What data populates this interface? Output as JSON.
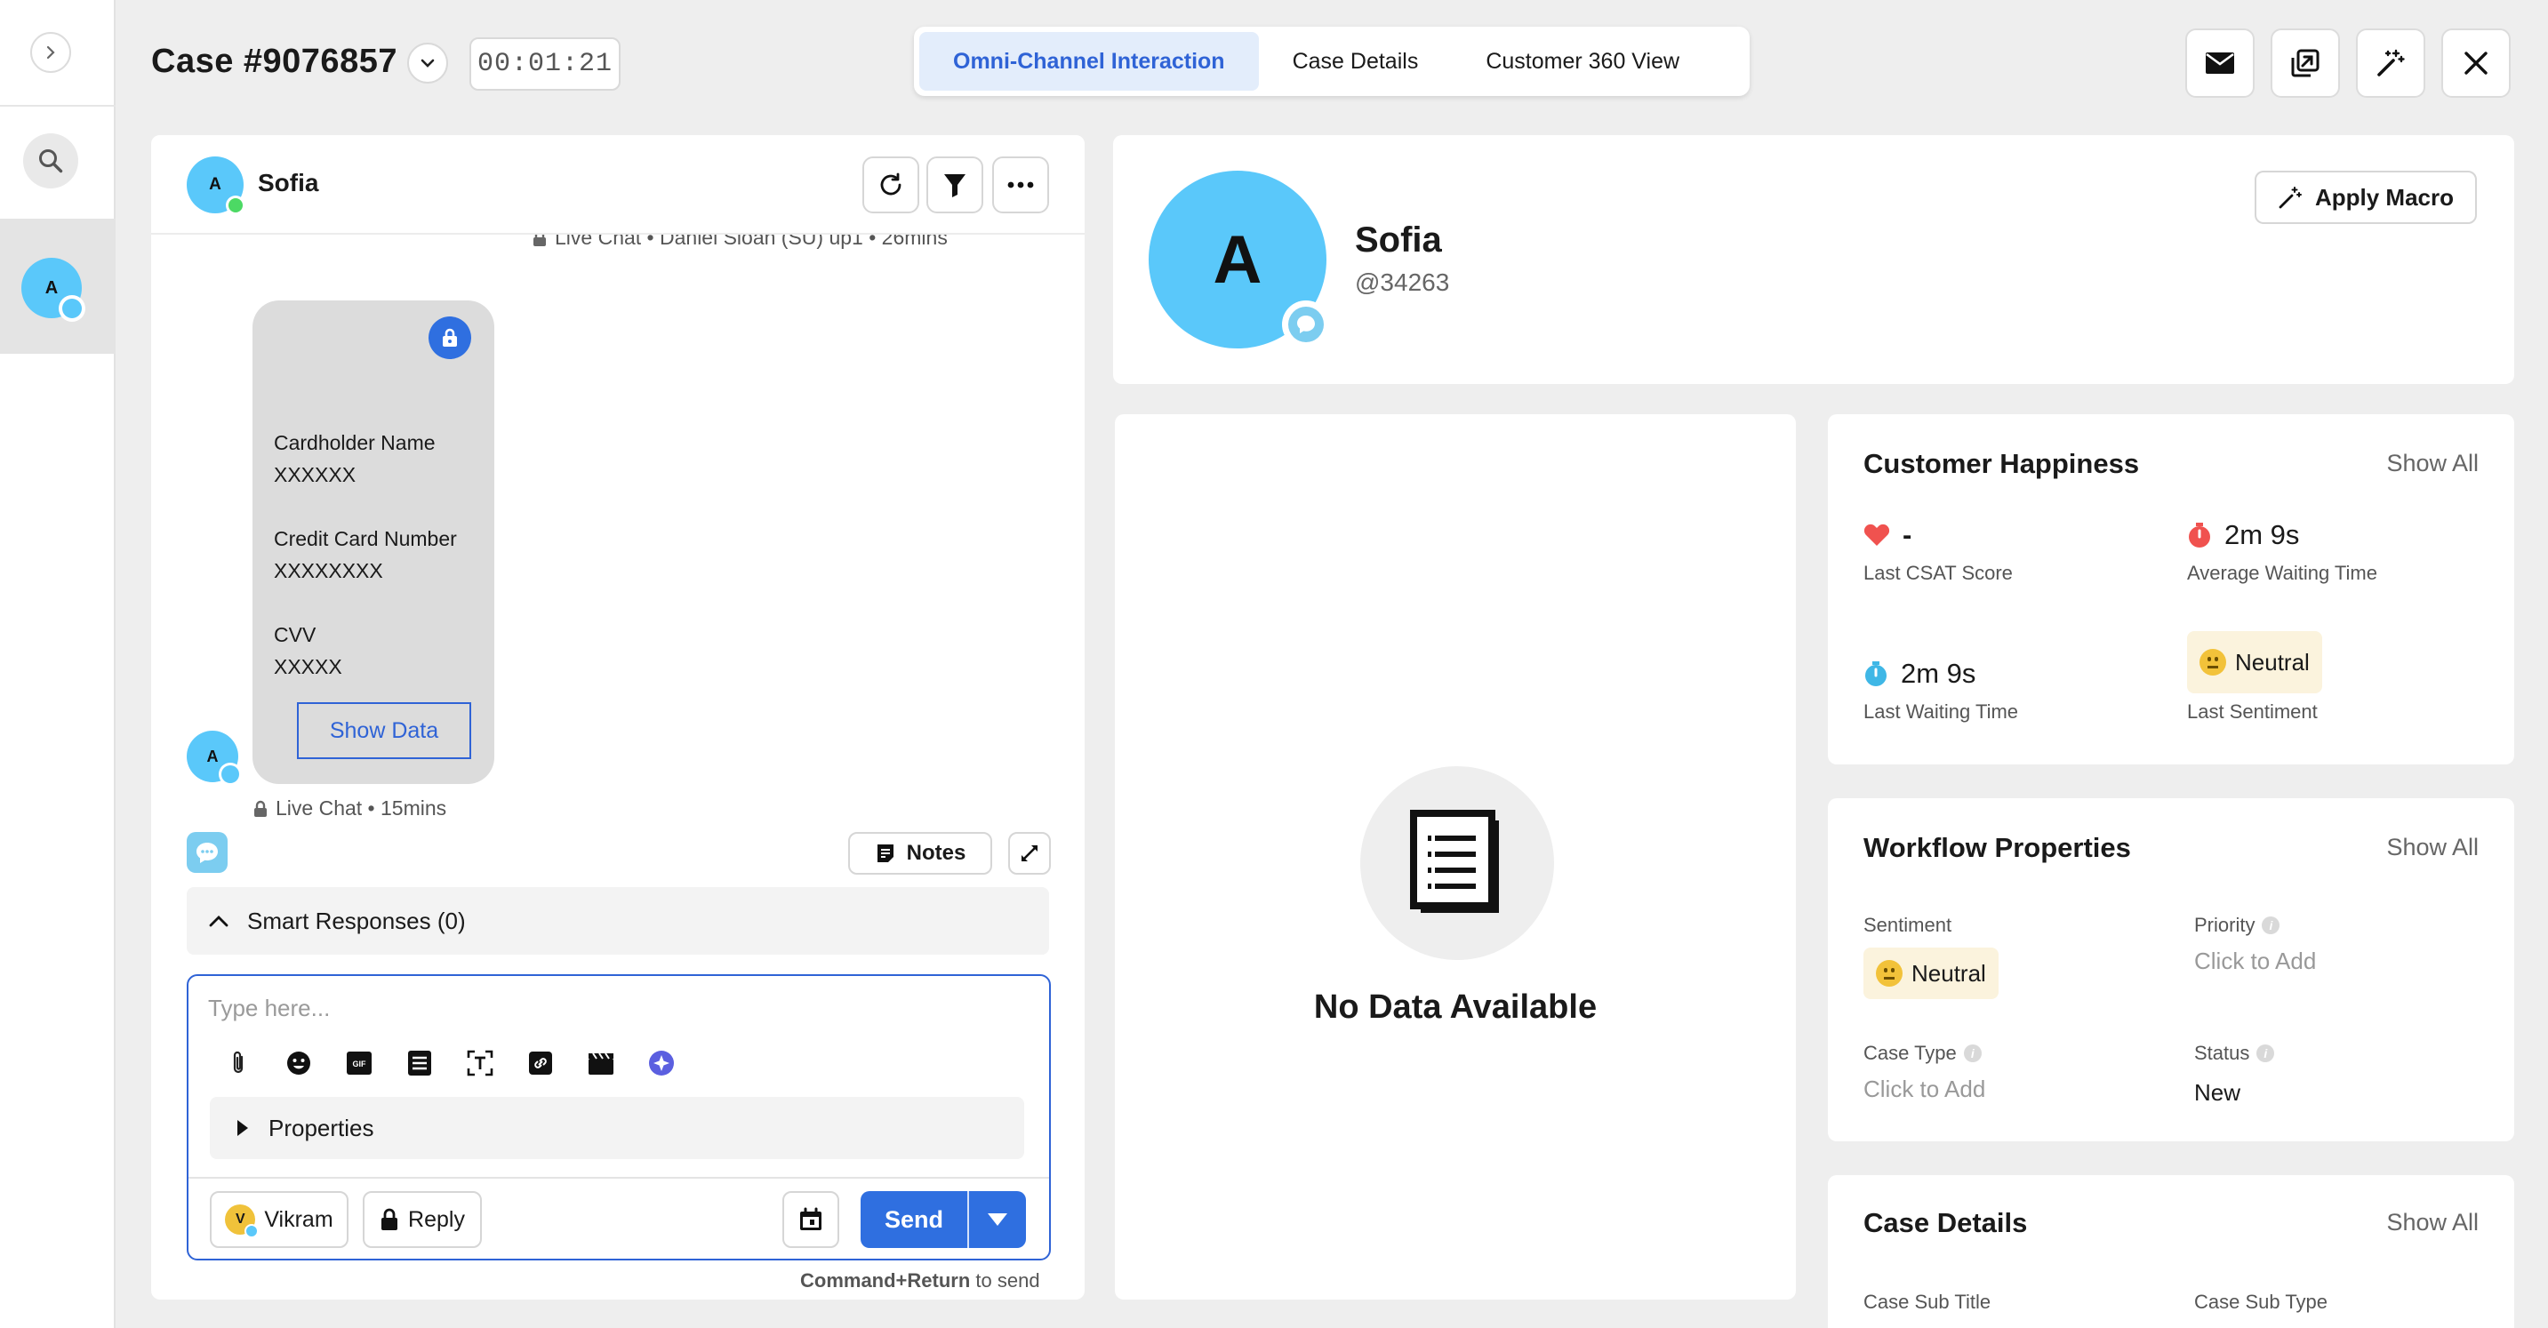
{
  "header": {
    "case_title": "Case #9076857",
    "timer": "00:01:21",
    "tabs": [
      {
        "label": "Omni-Channel Interaction",
        "active": true
      },
      {
        "label": "Case Details",
        "active": false
      },
      {
        "label": "Customer 360 View",
        "active": false
      }
    ],
    "actions": [
      "mail-icon",
      "popout-icon",
      "magic-wand-icon",
      "close-icon"
    ]
  },
  "rail": {
    "active_avatar_letter": "A"
  },
  "chat": {
    "contact_name": "Sofia",
    "avatar_letter": "A",
    "top_meta": "Live Chat • Daniel Sloan (SU) up1 • 26mins",
    "secure_card": {
      "cardholder_label": "Cardholder Name",
      "cardholder_value": "XXXXXX",
      "card_number_label": "Credit Card Number",
      "card_number_value": "XXXXXXXX",
      "cvv_label": "CVV",
      "cvv_value": "XXXXX",
      "show_data_label": "Show Data"
    },
    "bottom_meta": "Live Chat • 15mins",
    "notes_label": "Notes",
    "smart_responses_label": "Smart Responses (0)",
    "composer": {
      "placeholder": "Type here...",
      "properties_label": "Properties",
      "agent_name": "Vikram",
      "agent_initial": "V",
      "reply_label": "Reply",
      "send_label": "Send",
      "hint_key": "Command+Return",
      "hint_rest": " to send"
    }
  },
  "profile": {
    "avatar_letter": "A",
    "name": "Sofia",
    "handle": "@34263",
    "apply_macro_label": "Apply Macro"
  },
  "nodata": {
    "message": "No Data Available"
  },
  "happiness": {
    "title": "Customer Happiness",
    "show_all": "Show All",
    "csat_value": "-",
    "csat_label": "Last CSAT Score",
    "avg_wait_value": "2m 9s",
    "avg_wait_label": "Average Waiting Time",
    "last_wait_value": "2m 9s",
    "last_wait_label": "Last Waiting Time",
    "sentiment_value": "Neutral",
    "sentiment_label": "Last Sentiment"
  },
  "workflow": {
    "title": "Workflow Properties",
    "show_all": "Show All",
    "sentiment_label": "Sentiment",
    "sentiment_value": "Neutral",
    "priority_label": "Priority",
    "priority_value": "Click to Add",
    "case_type_label": "Case Type",
    "case_type_value": "Click to Add",
    "status_label": "Status",
    "status_value": "New"
  },
  "case_details": {
    "title": "Case Details",
    "show_all": "Show All",
    "sub_title_label": "Case Sub Title",
    "sub_type_label": "Case Sub Type"
  },
  "colors": {
    "accent": "#2f63d6",
    "avatar": "#5ac8fa",
    "online": "#4cd964",
    "heart": "#f0524f",
    "neutral_bg": "#fbf3dd"
  }
}
